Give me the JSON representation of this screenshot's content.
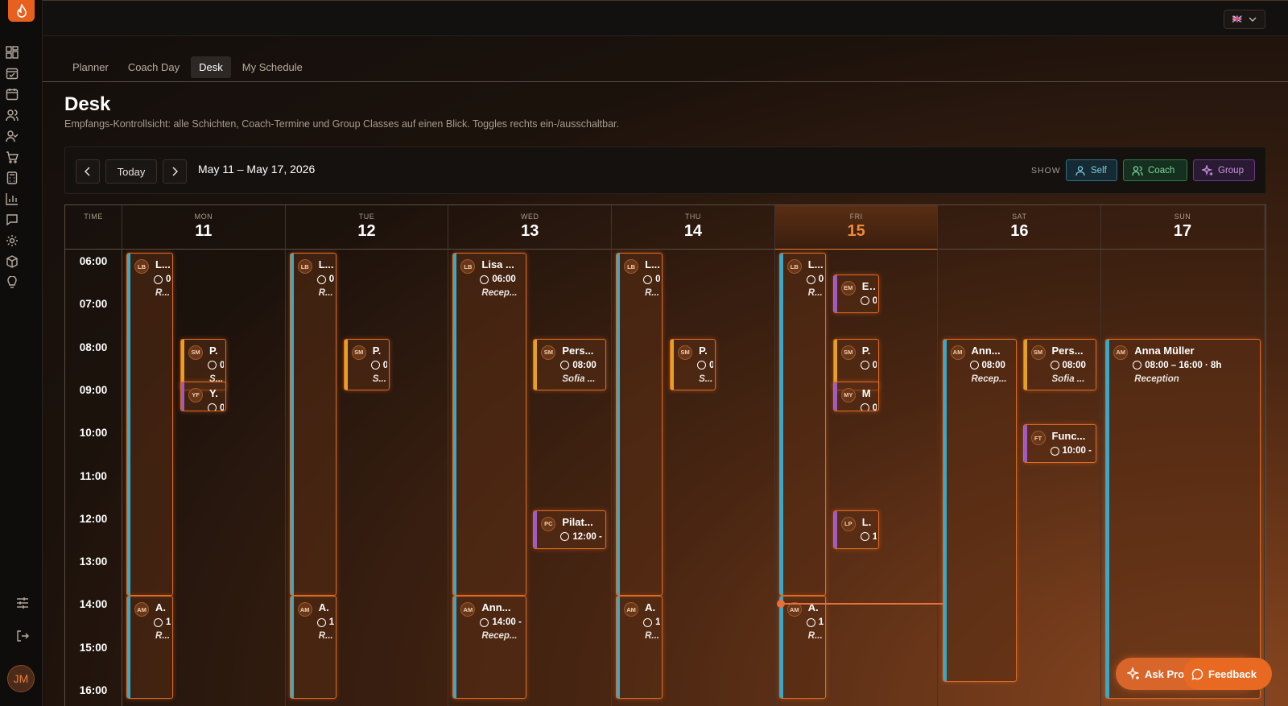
{
  "app": {
    "user_initials": "JM",
    "lang_flag": "🇬🇧"
  },
  "tabs": [
    {
      "label": "Planner"
    },
    {
      "label": "Coach Day"
    },
    {
      "label": "Desk"
    },
    {
      "label": "My Schedule"
    }
  ],
  "page": {
    "title": "Desk",
    "subtitle": "Empfangs-Kontrollsicht: alle Schichten, Coach-Termine und Group Classes auf einen Blick. Toggles rechts ein-/ausschaltbar."
  },
  "toolbar": {
    "today_label": "Today",
    "range": "May 11 – May 17, 2026",
    "show_label": "SHOW",
    "toggles": [
      {
        "label": "Self",
        "color": "#3aa8c8"
      },
      {
        "label": "Coach",
        "color": "#3ab870"
      },
      {
        "label": "Group",
        "color": "#a05ac0"
      }
    ]
  },
  "calendar": {
    "time_header": "TIME",
    "times": [
      "06:00",
      "07:00",
      "08:00",
      "09:00",
      "10:00",
      "11:00",
      "12:00",
      "13:00",
      "14:00",
      "15:00",
      "16:00"
    ],
    "days": [
      {
        "name": "MON",
        "date": "11"
      },
      {
        "name": "TUE",
        "date": "12"
      },
      {
        "name": "WED",
        "date": "13"
      },
      {
        "name": "THU",
        "date": "14"
      },
      {
        "name": "FRI",
        "date": "15",
        "today": true
      },
      {
        "name": "SAT",
        "date": "16"
      },
      {
        "name": "SUN",
        "date": "17"
      }
    ],
    "events": [
      {
        "day": 0,
        "kind": "self",
        "ini": "LB",
        "name": "L...",
        "time": "0",
        "role": "R..."
      },
      {
        "day": 0,
        "kind": "coach",
        "ini": "SM",
        "name": "P.",
        "time": "0",
        "role": "S..."
      },
      {
        "day": 0,
        "kind": "group",
        "ini": "YF",
        "name": "Y.",
        "time": "0",
        "role": ""
      },
      {
        "day": 0,
        "kind": "self",
        "ini": "AM",
        "name": "A.",
        "time": "1",
        "role": "R..."
      },
      {
        "day": 1,
        "kind": "self",
        "ini": "LB",
        "name": "L...",
        "time": "0",
        "role": "R..."
      },
      {
        "day": 1,
        "kind": "coach",
        "ini": "SM",
        "name": "P.",
        "time": "0",
        "role": "S..."
      },
      {
        "day": 1,
        "kind": "self",
        "ini": "AM",
        "name": "A.",
        "time": "1",
        "role": "R..."
      },
      {
        "day": 2,
        "kind": "self",
        "ini": "LB",
        "name": "Lisa ...",
        "time": "06:00",
        "role": "Recep..."
      },
      {
        "day": 2,
        "kind": "coach",
        "ini": "SM",
        "name": "Pers...",
        "time": "08:00",
        "role": "Sofia ..."
      },
      {
        "day": 2,
        "kind": "group",
        "ini": "PC",
        "name": "Pilat...",
        "time": "12:00 -",
        "role": ""
      },
      {
        "day": 2,
        "kind": "self",
        "ini": "AM",
        "name": "Ann...",
        "time": "14:00 -",
        "role": "Recep..."
      },
      {
        "day": 3,
        "kind": "self",
        "ini": "LB",
        "name": "L...",
        "time": "0",
        "role": "R..."
      },
      {
        "day": 3,
        "kind": "coach",
        "ini": "SM",
        "name": "P.",
        "time": "0",
        "role": "S..."
      },
      {
        "day": 3,
        "kind": "self",
        "ini": "AM",
        "name": "A.",
        "time": "1",
        "role": "R..."
      },
      {
        "day": 4,
        "kind": "self",
        "ini": "LB",
        "name": "L...",
        "time": "0",
        "role": "R..."
      },
      {
        "day": 4,
        "kind": "group",
        "ini": "EM",
        "name": "E...",
        "time": "0",
        "role": ""
      },
      {
        "day": 4,
        "kind": "coach",
        "ini": "SM",
        "name": "P.",
        "time": "0",
        "role": ""
      },
      {
        "day": 4,
        "kind": "group",
        "ini": "MY",
        "name": "M",
        "time": "0",
        "role": ""
      },
      {
        "day": 4,
        "kind": "group",
        "ini": "LP",
        "name": "L.",
        "time": "1",
        "role": ""
      },
      {
        "day": 4,
        "kind": "self",
        "ini": "AM",
        "name": "A.",
        "time": "1",
        "role": "R..."
      },
      {
        "day": 5,
        "kind": "self",
        "ini": "AM",
        "name": "Ann...",
        "time": "08:00",
        "role": "Recep..."
      },
      {
        "day": 5,
        "kind": "coach",
        "ini": "SM",
        "name": "Pers...",
        "time": "08:00",
        "role": "Sofia ..."
      },
      {
        "day": 5,
        "kind": "group",
        "ini": "FT",
        "name": "Func...",
        "time": "10:00 -",
        "role": ""
      },
      {
        "day": 6,
        "kind": "self",
        "ini": "AM",
        "name": "Anna Müller",
        "time": "08:00 – 16:00 · 8h",
        "role": "Reception"
      }
    ]
  },
  "fab": {
    "ask_label": "Ask Pro",
    "feedback_label": "Feedback"
  }
}
